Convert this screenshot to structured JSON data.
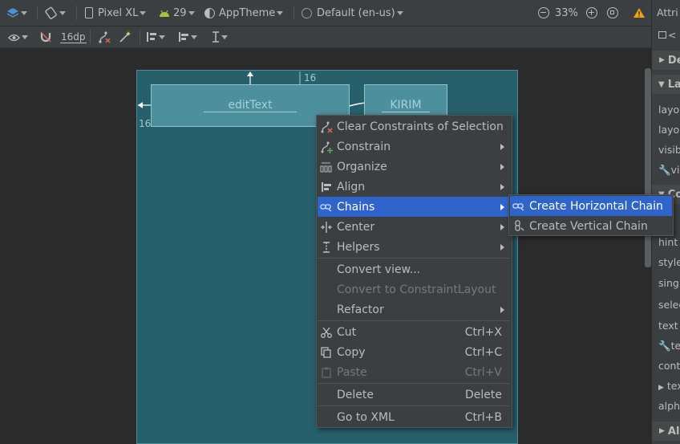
{
  "toolbar_top": {
    "device": "Pixel XL",
    "api_level": "29",
    "theme": "AppTheme",
    "locale": "Default (en-us)",
    "zoom": "33%"
  },
  "toolbar_second": {
    "default_margin": "16dp"
  },
  "canvas": {
    "edittext_label": "editText",
    "button_label": "KIRIM",
    "margin_top": "16",
    "margin_left": "16"
  },
  "attributes_panel": {
    "title": "Attri",
    "sections": [
      "De",
      "La",
      "Co",
      "Al"
    ],
    "rows": [
      "layo",
      "layo",
      "visib",
      "vis",
      "hint",
      "style",
      "sing",
      "selec",
      "text",
      "tex",
      "cont",
      "tex",
      "alph"
    ]
  },
  "context_menu": {
    "items": [
      {
        "label": "Clear Constraints of Selection",
        "icon": "clear-constraints-icon"
      },
      {
        "label": "Constrain",
        "icon": "constrain-icon",
        "submenu": true
      },
      {
        "label": "Organize",
        "icon": "organize-icon",
        "submenu": true
      },
      {
        "label": "Align",
        "icon": "align-icon",
        "submenu": true
      },
      {
        "label": "Chains",
        "icon": "chains-icon",
        "submenu": true,
        "selected": true
      },
      {
        "label": "Center",
        "icon": "center-icon",
        "submenu": true
      },
      {
        "label": "Helpers",
        "icon": "helpers-icon",
        "submenu": true
      },
      {
        "label": "Convert view..."
      },
      {
        "label": "Convert to ConstraintLayout",
        "disabled": true
      },
      {
        "label": "Refactor",
        "submenu": true
      },
      {
        "label": "Cut",
        "shortcut": "Ctrl+X",
        "icon": "cut-icon"
      },
      {
        "label": "Copy",
        "shortcut": "Ctrl+C",
        "icon": "copy-icon"
      },
      {
        "label": "Paste",
        "shortcut": "Ctrl+V",
        "icon": "paste-icon",
        "disabled": true
      },
      {
        "label": "Delete",
        "shortcut": "Delete"
      },
      {
        "label": "Go to XML",
        "shortcut": "Ctrl+B"
      }
    ]
  },
  "chains_submenu": {
    "items": [
      {
        "label": "Create Horizontal Chain",
        "icon": "horizontal-chain-icon",
        "selected": true
      },
      {
        "label": "Create Vertical Chain",
        "icon": "vertical-chain-icon"
      }
    ]
  },
  "colors": {
    "selection": "#2f65ca",
    "device_background": "#275f6b",
    "warning": "#f0a30a",
    "android_green": "#a4c639"
  }
}
